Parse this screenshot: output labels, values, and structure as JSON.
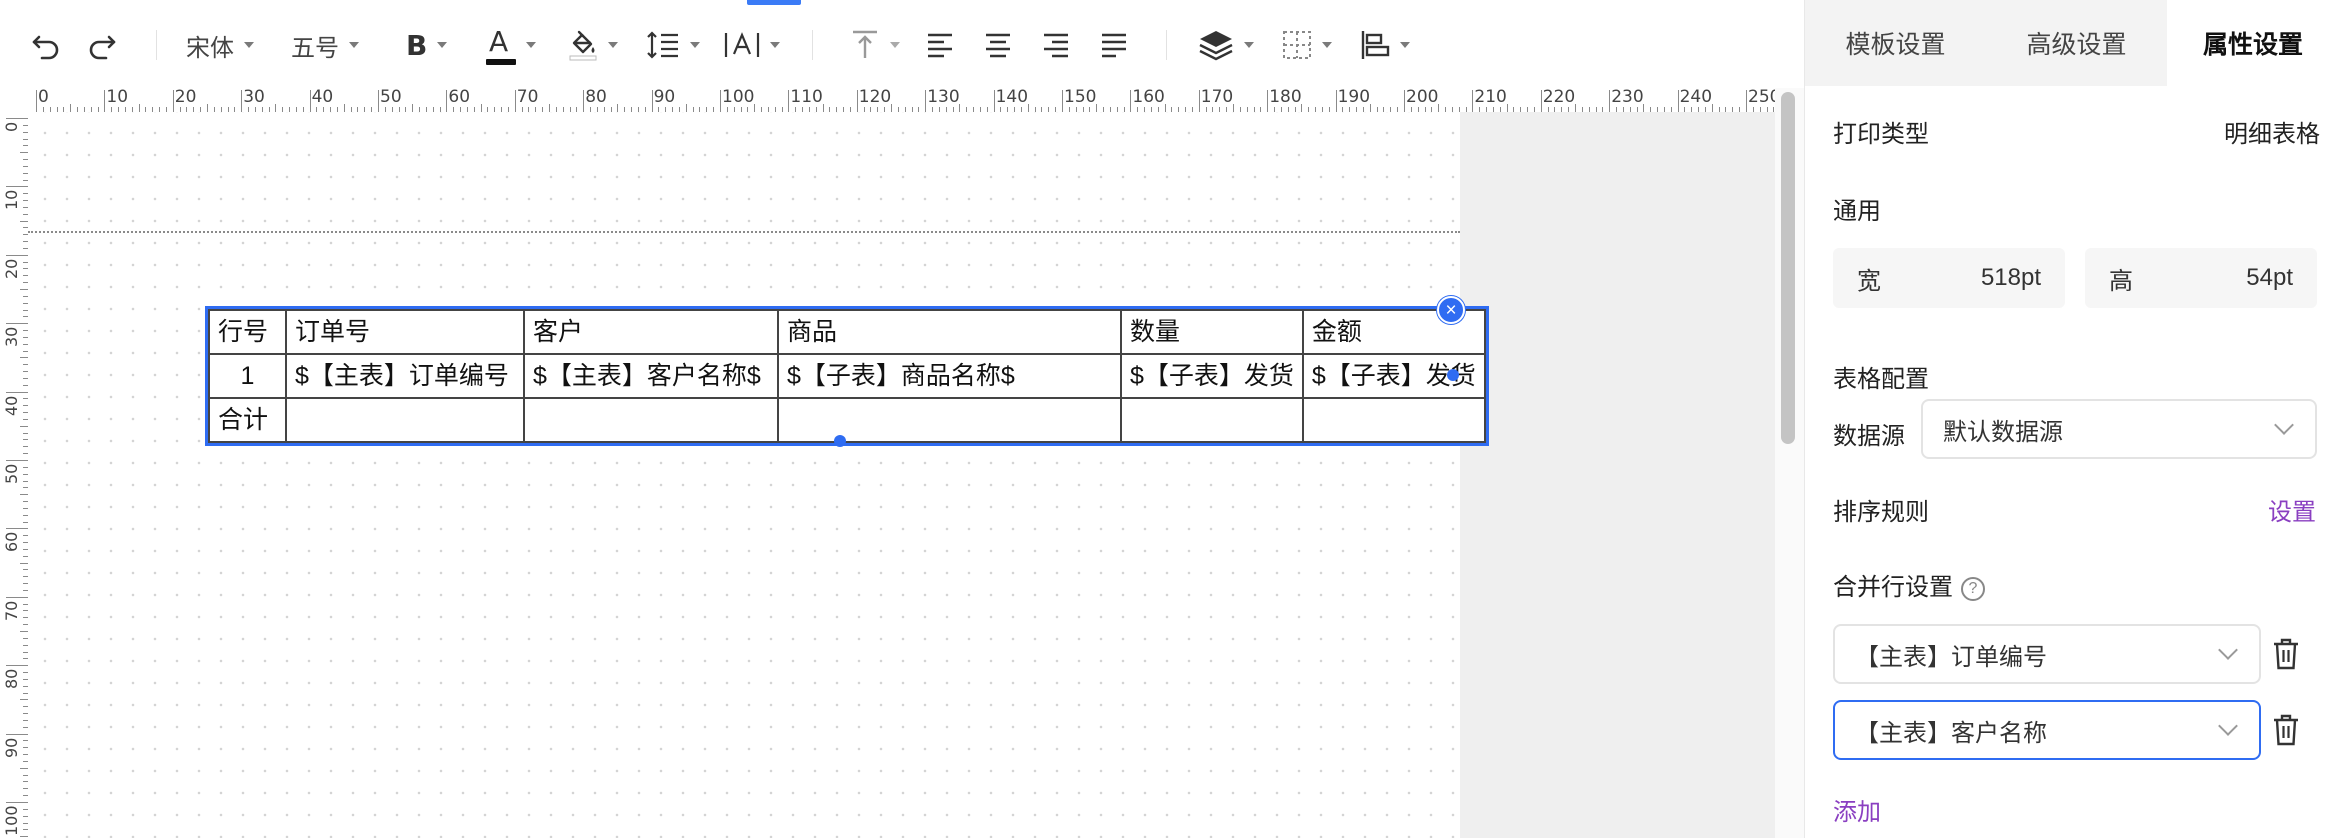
{
  "toolbar": {
    "font_family": "宋体",
    "font_size": "五号",
    "bold_label": "B",
    "font_color_label": "A",
    "font_color": "#111111"
  },
  "ruler": {
    "top_labels": [
      "0",
      "10",
      "20",
      "30",
      "40",
      "50",
      "60",
      "70",
      "80",
      "90",
      "100",
      "110",
      "120",
      "130",
      "140",
      "150",
      "160",
      "170",
      "180",
      "190",
      "200",
      "210",
      "220",
      "230",
      "240",
      "250"
    ],
    "left_labels": [
      "0",
      "10",
      "20",
      "30",
      "40",
      "50",
      "60",
      "70",
      "80",
      "90",
      "100"
    ]
  },
  "table": {
    "header": [
      "行号",
      "订单号",
      "客户",
      "商品",
      "数量",
      "金额"
    ],
    "row1": [
      "1",
      "$【主表】订单编号",
      "$【主表】客户名称$",
      "$【子表】商品名称$",
      "$【子表】发货",
      "$【子表】发货"
    ],
    "total": [
      "合计",
      "",
      "",
      "",
      "",
      ""
    ],
    "close_label": "×"
  },
  "panel": {
    "tabs": [
      "模板设置",
      "高级设置",
      "属性设置"
    ],
    "active_tab": 2,
    "print_type_label": "打印类型",
    "print_type_value": "明细表格",
    "general_label": "通用",
    "width_label": "宽",
    "width_value": "518pt",
    "height_label": "高",
    "height_value": "54pt",
    "table_config_label": "表格配置",
    "datasource_label": "数据源",
    "datasource_value": "默认数据源",
    "sort_label": "排序规则",
    "sort_action": "设置",
    "merge_label": "合并行设置",
    "help_glyph": "?",
    "merge_items": [
      "【主表】订单编号",
      "【主表】客户名称"
    ],
    "add_label": "添加"
  },
  "colors": {
    "accent": "#2f6cf2",
    "link": "#8a3fc1"
  }
}
